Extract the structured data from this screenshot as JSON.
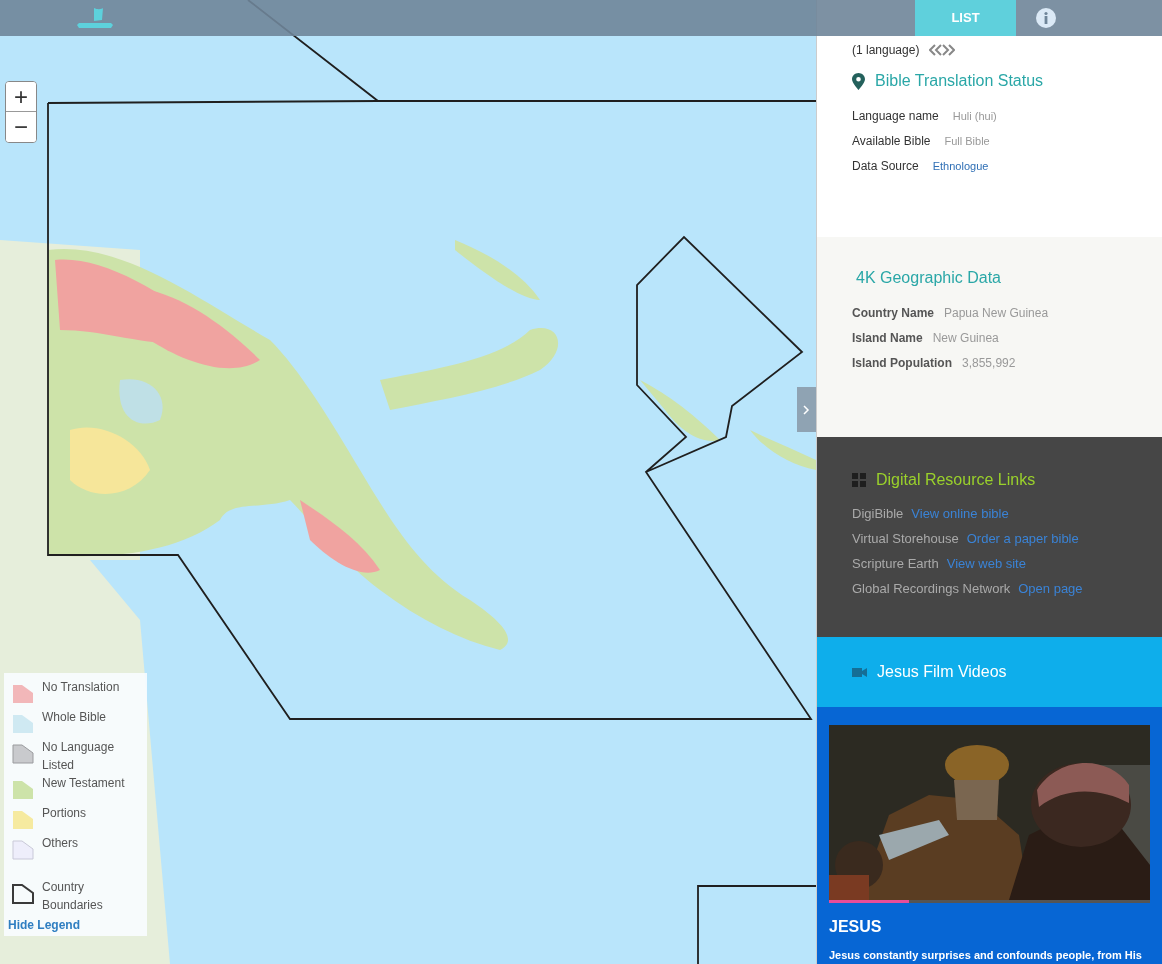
{
  "header": {
    "tabs": [
      {
        "label": "LIST",
        "selected": true
      }
    ]
  },
  "map": {
    "kind": "picture",
    "zoom": {
      "in": "+",
      "out": "−"
    }
  },
  "legend": {
    "items": [
      {
        "label": "No Translation",
        "color": "#f2b7b9",
        "kind": "fill"
      },
      {
        "label": "Whole Bible",
        "color": "#cfe9f2",
        "kind": "fill"
      },
      {
        "label": "No Language Listed",
        "color": "#c9cacd",
        "kind": "fill"
      },
      {
        "label": "New Testament",
        "color": "#cde3a9",
        "kind": "fill"
      },
      {
        "label": "Portions",
        "color": "#f6eaa0",
        "kind": "fill"
      },
      {
        "label": "Others",
        "color": "#eeeefb",
        "kind": "fill"
      },
      {
        "label": "Country Boundaries",
        "color": "#3a3a3a",
        "kind": "outline"
      }
    ],
    "hide_link": "Hide Legend"
  },
  "translation": {
    "count": "(1 language)",
    "title": "Bible Translation Status",
    "fields": [
      {
        "label": "Language name",
        "value": "Huli (hui)",
        "kind": "text"
      },
      {
        "label": "Available Bible",
        "value": "Full Bible",
        "kind": "text"
      },
      {
        "label": "Data Source",
        "value": "Ethnologue",
        "kind": "link"
      }
    ]
  },
  "geographic": {
    "title": "4K Geographic Data",
    "fields": [
      {
        "label": "Country Name",
        "value": "Papua New Guinea"
      },
      {
        "label": "Island Name",
        "value": "New Guinea"
      },
      {
        "label": "Island Population",
        "value": "3,855,992"
      }
    ]
  },
  "resources": {
    "title": "Digital Resource Links",
    "links": [
      {
        "label": "DigiBible",
        "link": "View online bible"
      },
      {
        "label": "Virtual Storehouse",
        "link": "Order a paper bible"
      },
      {
        "label": "Scripture Earth",
        "link": "View web site"
      },
      {
        "label": "Global Recordings Network",
        "link": "Open page"
      }
    ]
  },
  "videos": {
    "title": "Jesus Film Videos",
    "video": {
      "kind": "picture",
      "level": 0.25,
      "title": "JESUS",
      "description": "Jesus constantly surprises and confounds people, from His"
    }
  }
}
